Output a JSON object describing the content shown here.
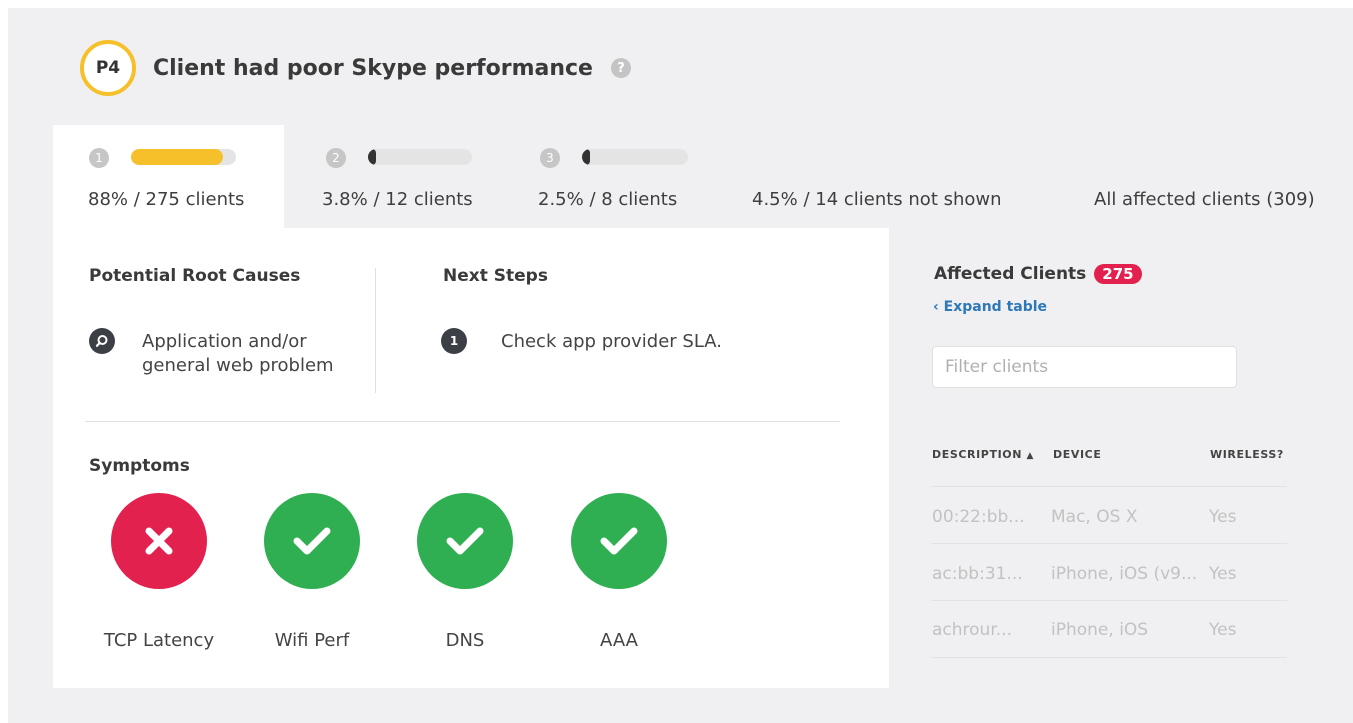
{
  "header": {
    "priority": "P4",
    "title": "Client had poor Skype performance",
    "help": "?"
  },
  "tabs": [
    {
      "num": "1",
      "label": "88% / 275 clients",
      "fraction": 0.88,
      "color": "#f5c02a"
    },
    {
      "num": "2",
      "label": "3.8% / 12 clients",
      "fraction": 0.038,
      "color": "#333333"
    },
    {
      "num": "3",
      "label": "2.5% / 8 clients",
      "fraction": 0.025,
      "color": "#333333"
    }
  ],
  "not_shown": "4.5% / 14 clients not shown",
  "all_affected": "All affected clients (309)",
  "root_causes": {
    "title": "Potential Root Causes",
    "item_line1": "Application and/or",
    "item_line2": "general web problem"
  },
  "next_steps": {
    "title": "Next Steps",
    "num": "1",
    "item": "Check app provider SLA."
  },
  "symptoms": {
    "title": "Symptoms",
    "items": [
      {
        "label": "TCP Latency",
        "status": "fail"
      },
      {
        "label": "Wifi Perf",
        "status": "ok"
      },
      {
        "label": "DNS",
        "status": "ok"
      },
      {
        "label": "AAA",
        "status": "ok"
      }
    ]
  },
  "affected": {
    "title": "Affected Clients",
    "count": "275",
    "expand": "Expand table",
    "filter_placeholder": "Filter clients",
    "columns": [
      "DESCRIPTION",
      "DEVICE",
      "WIRELESS?"
    ],
    "rows": [
      [
        "00:22:bb...",
        "Mac, OS X",
        "Yes"
      ],
      [
        "ac:bb:31...",
        "iPhone, iOS (v9...",
        "Yes"
      ],
      [
        "achrour...",
        "iPhone, iOS",
        "Yes"
      ]
    ]
  },
  "colors": {
    "accent": "#f5c02a",
    "fail": "#e3214f",
    "ok": "#2fae52",
    "link": "#2f78b8"
  }
}
